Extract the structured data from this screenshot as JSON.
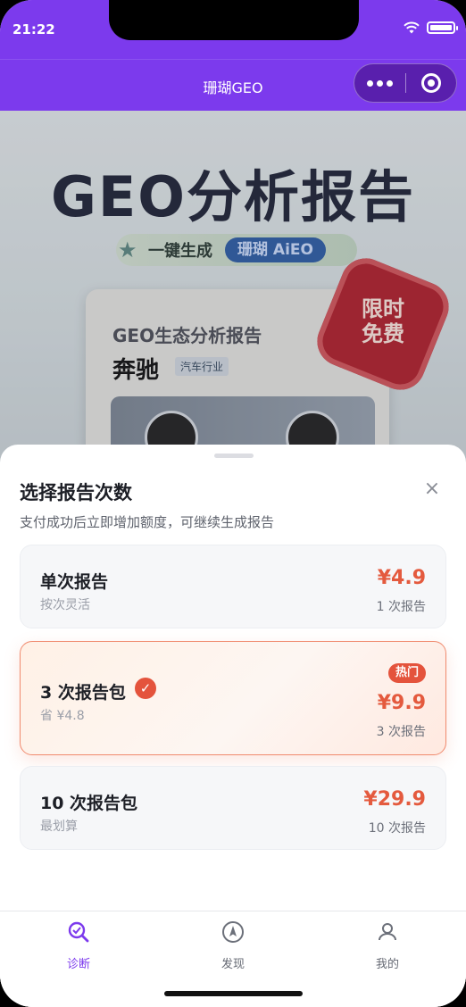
{
  "status": {
    "time": "21:22"
  },
  "nav": {
    "title": "珊瑚GEO"
  },
  "banner": {
    "title": "GEO分析报告",
    "tagline": "一键生成",
    "tagline_badge": "珊瑚 AiEO",
    "card_title": "GEO生态分析报告",
    "brand": "奔驰",
    "industry": "汽车行业",
    "seal_line1": "限时",
    "seal_line2": "免费"
  },
  "sheet": {
    "title": "选择报告次数",
    "subtitle": "支付成功后立即增加额度，可继续生成报告",
    "options": [
      {
        "name": "单次报告",
        "desc": "按次灵活",
        "price": "¥4.9",
        "count": "1 次报告",
        "selected": false
      },
      {
        "name": "3 次报告包",
        "desc": "省 ¥4.8",
        "price": "¥9.9",
        "count": "3 次报告",
        "badge": "热门",
        "selected": true
      },
      {
        "name": "10 次报告包",
        "desc": "最划算",
        "price": "¥29.9",
        "count": "10 次报告",
        "selected": false
      }
    ]
  },
  "tabs": [
    {
      "label": "诊断",
      "icon": "diagnose-search-icon",
      "active": true
    },
    {
      "label": "发现",
      "icon": "compass-icon",
      "active": false
    },
    {
      "label": "我的",
      "icon": "user-icon",
      "active": false
    }
  ],
  "colors": {
    "brand": "#7c3aed",
    "price": "#e45a3e",
    "hot": "#e4533c"
  }
}
